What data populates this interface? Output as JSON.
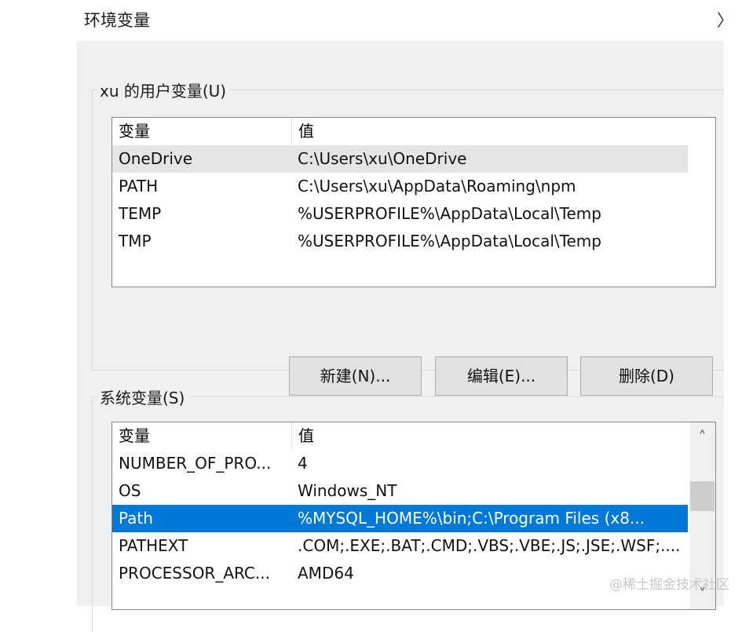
{
  "window": {
    "title": "环境变量",
    "close_glyph": "〉"
  },
  "user_vars": {
    "group_label": "xu 的用户变量(U)",
    "columns": {
      "name": "变量",
      "value": "值"
    },
    "rows": [
      {
        "name": "OneDrive",
        "value": "C:\\Users\\xu\\OneDrive",
        "state": "hover"
      },
      {
        "name": "PATH",
        "value": "C:\\Users\\xu\\AppData\\Roaming\\npm",
        "state": ""
      },
      {
        "name": "TEMP",
        "value": "%USERPROFILE%\\AppData\\Local\\Temp",
        "state": ""
      },
      {
        "name": "TMP",
        "value": "%USERPROFILE%\\AppData\\Local\\Temp",
        "state": ""
      }
    ],
    "buttons": {
      "new": "新建(N)...",
      "edit": "编辑(E)...",
      "delete": "删除(D)"
    }
  },
  "system_vars": {
    "group_label": "系统变量(S)",
    "columns": {
      "name": "变量",
      "value": "值"
    },
    "rows": [
      {
        "name": "NUMBER_OF_PRO...",
        "value": "4",
        "state": ""
      },
      {
        "name": "OS",
        "value": "Windows_NT",
        "state": ""
      },
      {
        "name": "Path",
        "value": "%MYSQL_HOME%\\bin;C:\\Program Files (x8...",
        "state": "selected"
      },
      {
        "name": "PATHEXT",
        "value": ".COM;.EXE;.BAT;.CMD;.VBS;.VBE;.JS;.JSE;.WSF;....",
        "state": ""
      },
      {
        "name": "PROCESSOR_ARC...",
        "value": "AMD64",
        "state": ""
      }
    ],
    "scrollbar": {
      "up_icon": "chevron-up",
      "down_icon": "chevron-down",
      "up_glyph": "˄",
      "down_glyph": "˅"
    }
  },
  "watermark": "@稀土掘金技术社区",
  "colors": {
    "selection": "#0078d7",
    "hover": "#e5e5e5",
    "dialog_bg": "#f0f0f0",
    "button_bg": "#e1e1e1"
  }
}
